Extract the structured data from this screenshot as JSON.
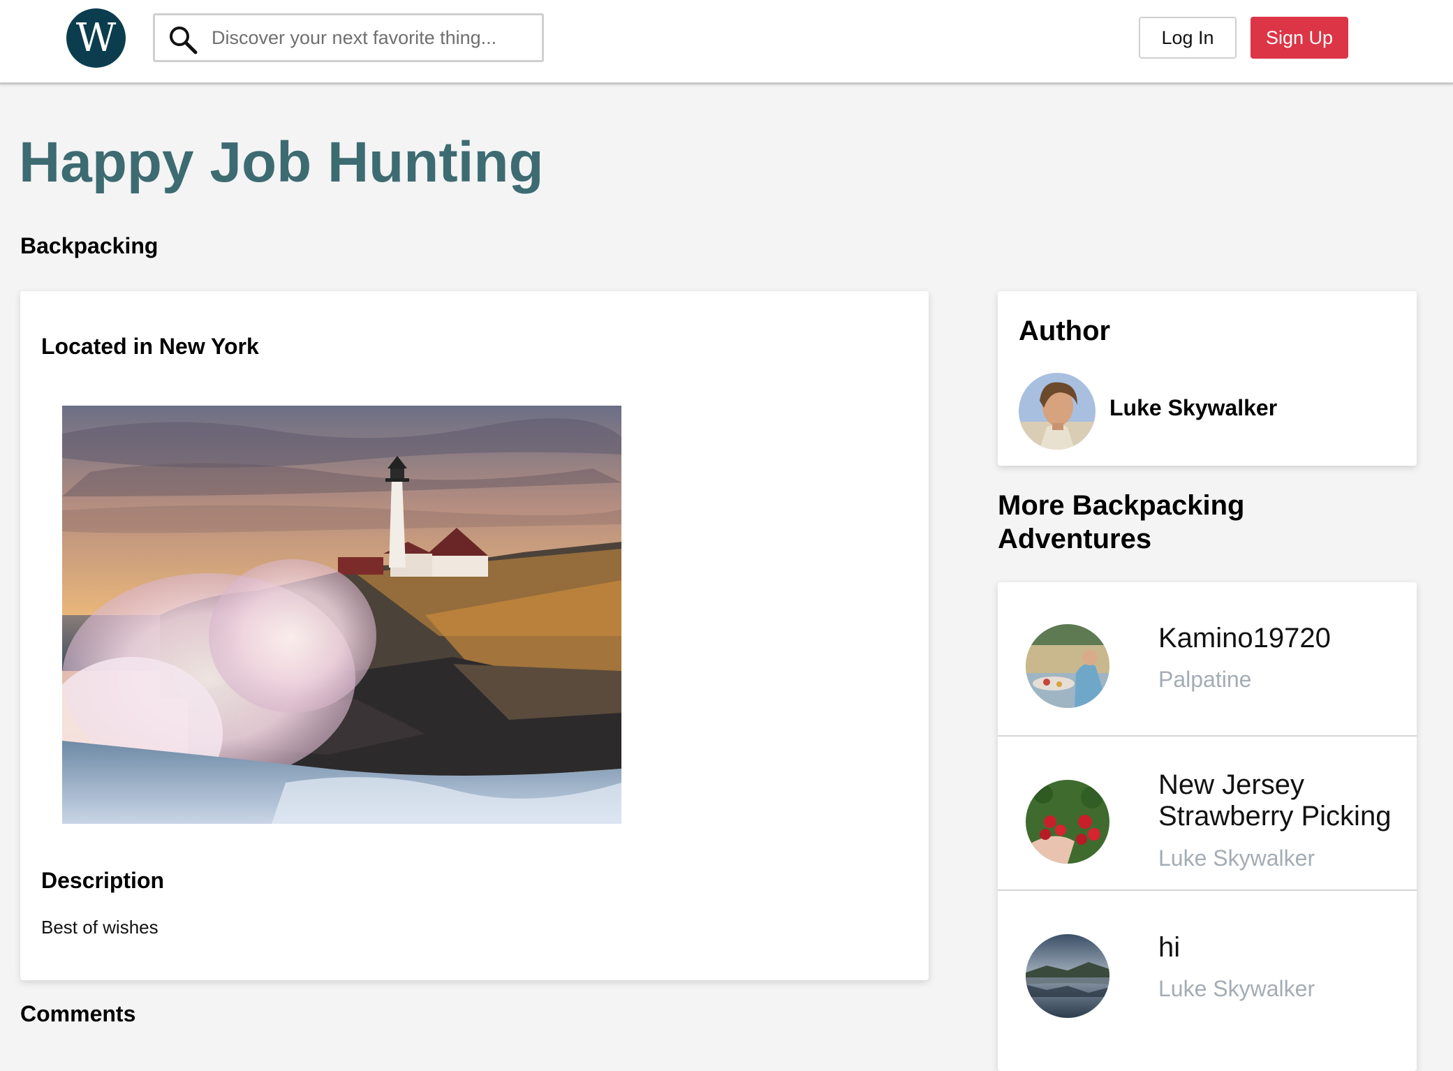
{
  "header": {
    "logo_letter": "W",
    "search_placeholder": "Discover your next favorite thing...",
    "login_label": "Log In",
    "signup_label": "Sign Up"
  },
  "page": {
    "title": "Happy Job Hunting",
    "category": "Backpacking"
  },
  "post": {
    "location": "Located in New York",
    "image_icon": "lighthouse-photo",
    "description_heading": "Description",
    "description": "Best of wishes"
  },
  "comments": {
    "heading": "Comments"
  },
  "author": {
    "heading": "Author",
    "name": "Luke Skywalker"
  },
  "more": {
    "heading": "More Backpacking Adventures",
    "items": [
      {
        "title": "Kamino19720",
        "author": "Palpatine",
        "thumb": "picnic-photo"
      },
      {
        "title": "New Jersey Strawberry Picking",
        "author": "Luke Skywalker",
        "thumb": "strawberries-photo"
      },
      {
        "title": "hi",
        "author": "Luke Skywalker",
        "thumb": "lake-photo"
      }
    ]
  },
  "colors": {
    "title": "#3d6b72",
    "logo_bg": "#0b3d4f",
    "signup_bg": "#dc3545",
    "muted_author": "#a4acb4",
    "page_bg": "#f4f4f4"
  }
}
